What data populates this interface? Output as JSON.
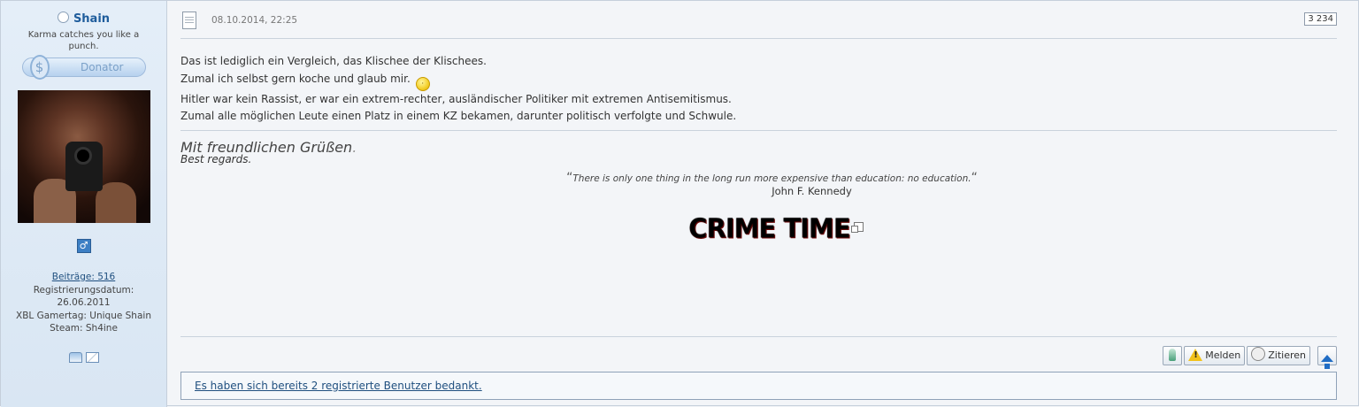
{
  "user": {
    "name": "Shain",
    "title": "Karma catches you like a punch.",
    "badge": "Donator",
    "gender_icon": "male-icon",
    "posts_label": "Beiträge: 516",
    "registration_label": "Registrierungsdatum:",
    "registration_date": "26.06.2011",
    "xbl": "XBL Gamertag: Unique Shain",
    "steam": "Steam: Sh4ine"
  },
  "post": {
    "date": "08.10.2014, 22:25",
    "number": "3 234",
    "lines": [
      "Das ist lediglich ein Vergleich, das Klischee der Klischees.",
      "Zumal ich selbst gern koche und glaub mir.",
      "Hitler war kein Rassist, er war ein extrem-rechter, ausländischer Politiker mit extremen Antisemitismus.",
      "Zumal alle möglichen Leute einen Platz in einem KZ bekamen, darunter politisch verfolgte und Schwule."
    ]
  },
  "signature": {
    "greeting": "Mit freundlichen Grüßen",
    "greeting_dot": ".",
    "regards": "Best regards.",
    "quote": "There is only one thing in the long run more expensive than education: no education.",
    "open_quote": "“",
    "close_quote": "“",
    "author": "John F. Kennedy",
    "logo_text": "CRIME TIME"
  },
  "actions": {
    "report": "Melden",
    "quote": "Zitieren"
  },
  "thanks": {
    "text": "Es haben sich bereits 2 registrierte Benutzer bedankt."
  },
  "colors": {
    "sidebar_bg": "#dde9f5",
    "link": "#1f4f7f",
    "username": "#1f5d9c"
  }
}
